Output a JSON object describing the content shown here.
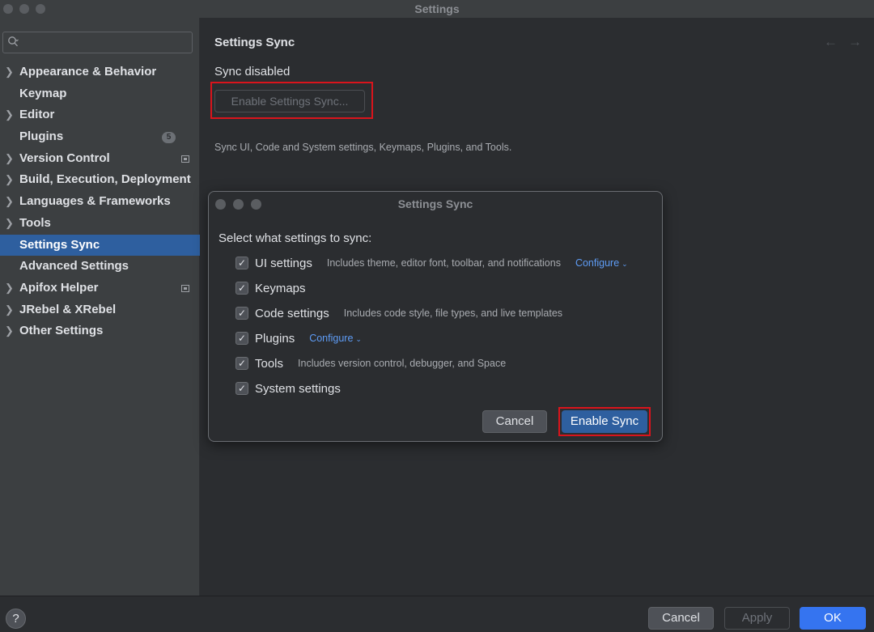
{
  "window": {
    "title": "Settings"
  },
  "sidebar": {
    "search": {
      "placeholder": "",
      "value": ""
    },
    "items": [
      {
        "label": "Appearance & Behavior",
        "expandable": true
      },
      {
        "label": "Keymap",
        "expandable": false
      },
      {
        "label": "Editor",
        "expandable": true
      },
      {
        "label": "Plugins",
        "expandable": false,
        "badge": "5"
      },
      {
        "label": "Version Control",
        "expandable": true,
        "project_icon": true
      },
      {
        "label": "Build, Execution, Deployment",
        "expandable": true
      },
      {
        "label": "Languages & Frameworks",
        "expandable": true
      },
      {
        "label": "Tools",
        "expandable": true
      },
      {
        "label": "Settings Sync",
        "expandable": false,
        "selected": true
      },
      {
        "label": "Advanced Settings",
        "expandable": false
      },
      {
        "label": "Apifox Helper",
        "expandable": true,
        "project_icon": true
      },
      {
        "label": "JRebel & XRebel",
        "expandable": true
      },
      {
        "label": "Other Settings",
        "expandable": true
      }
    ]
  },
  "main": {
    "title": "Settings Sync",
    "status": "Sync disabled",
    "enable_button": "Enable Settings Sync...",
    "description": "Sync UI, Code and System settings, Keymaps, Plugins, and Tools."
  },
  "dialog": {
    "title": "Settings Sync",
    "prompt": "Select what settings to sync:",
    "options": [
      {
        "label": "UI settings",
        "description": "Includes theme, editor font, toolbar, and notifications",
        "configure": "Configure",
        "checked": true
      },
      {
        "label": "Keymaps",
        "checked": true
      },
      {
        "label": "Code settings",
        "description": "Includes code style, file types, and live templates",
        "checked": true
      },
      {
        "label": "Plugins",
        "configure": "Configure",
        "checked": true
      },
      {
        "label": "Tools",
        "description": "Includes version control, debugger, and Space",
        "checked": true
      },
      {
        "label": "System settings",
        "checked": true
      }
    ],
    "cancel": "Cancel",
    "enable": "Enable Sync"
  },
  "footer": {
    "help": "?",
    "cancel": "Cancel",
    "apply": "Apply",
    "ok": "OK"
  },
  "colors": {
    "selection": "#2e5f9f",
    "primary_button": "#3574f0",
    "link": "#5e9cf5",
    "highlight_frame": "#d9141c"
  }
}
